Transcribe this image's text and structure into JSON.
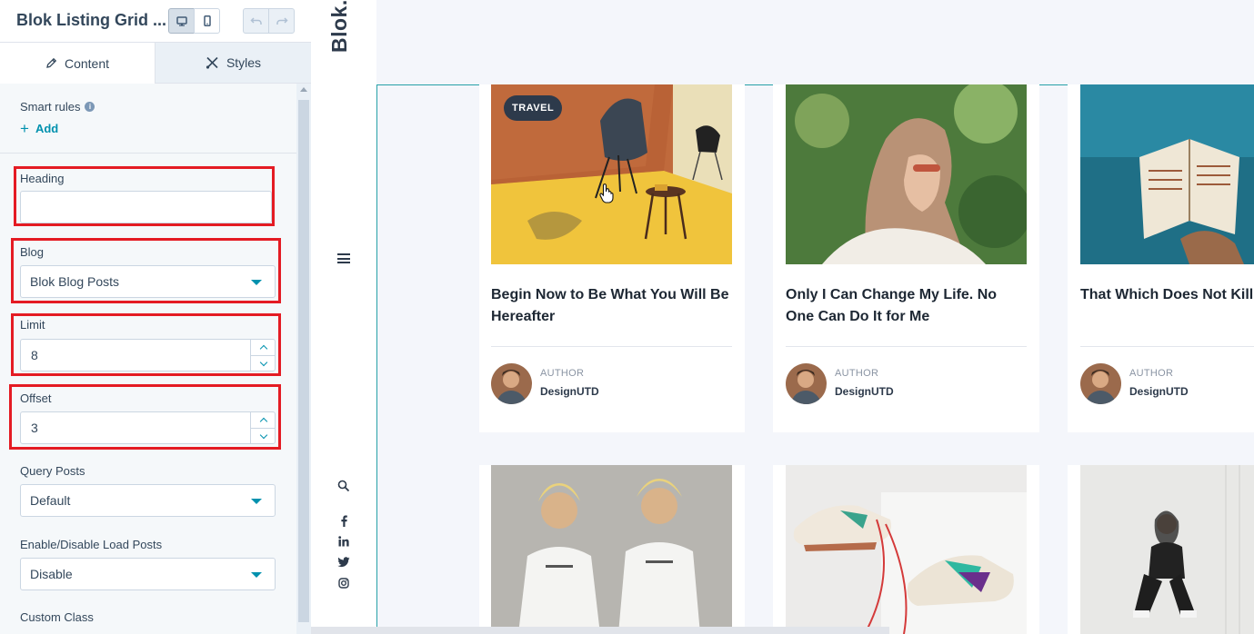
{
  "header": {
    "title": "Blok Listing Grid ...",
    "device_desktop": "desktop-icon",
    "device_mobile": "mobile-icon",
    "undo": "undo-icon",
    "redo": "redo-icon"
  },
  "tabs": [
    {
      "label": "Content",
      "icon": "pencil-icon",
      "active": true
    },
    {
      "label": "Styles",
      "icon": "brush-icon",
      "active": false
    }
  ],
  "form": {
    "smart_rules_label": "Smart rules",
    "info_glyph": "i",
    "add_label": "Add",
    "heading": {
      "label": "Heading",
      "value": ""
    },
    "blog": {
      "label": "Blog",
      "value": "Blok Blog Posts"
    },
    "limit": {
      "label": "Limit",
      "value": "8"
    },
    "offset": {
      "label": "Offset",
      "value": "3"
    },
    "query_posts": {
      "label": "Query Posts",
      "value": "Default"
    },
    "load_posts": {
      "label": "Enable/Disable Load Posts",
      "value": "Disable"
    },
    "custom_class": {
      "label": "Custom Class"
    }
  },
  "colors": {
    "accent": "#0091ae",
    "highlight": "#e41b23",
    "outline": "#27a1a8",
    "text": "#33475b"
  },
  "preview": {
    "logo": "Blok.",
    "nav_icons": [
      "menu-icon",
      "search-icon",
      "facebook-icon",
      "linkedin-icon",
      "twitter-icon",
      "instagram-icon"
    ],
    "cards": [
      {
        "badge": "TRAVEL",
        "title": "Begin Now to Be What You Will Be Hereafter",
        "author_label": "AUTHOR",
        "author": "DesignUTD"
      },
      {
        "badge": "",
        "title": "Only I Can Change My Life. No One Can Do It for Me",
        "author_label": "AUTHOR",
        "author": "DesignUTD"
      },
      {
        "badge": "",
        "title": "That Which Does Not Kill U Us Stronger",
        "author_label": "AUTHOR",
        "author": "DesignUTD"
      }
    ]
  }
}
